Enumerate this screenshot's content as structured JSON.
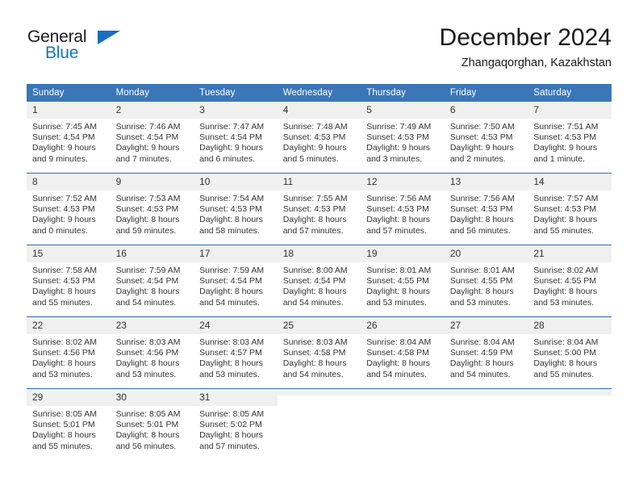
{
  "brand": {
    "name_part1": "General",
    "name_part2": "Blue",
    "flag_icon": "triangle-flag-icon"
  },
  "header": {
    "title": "December 2024",
    "location": "Zhangaqorghan, Kazakhstan"
  },
  "colors": {
    "header_blue": "#3b76b8",
    "row_divider_blue": "#2b6cb0",
    "daynum_band": "#f0f0f0",
    "brand_blue": "#1574c4"
  },
  "weekday_headers": [
    "Sunday",
    "Monday",
    "Tuesday",
    "Wednesday",
    "Thursday",
    "Friday",
    "Saturday"
  ],
  "weeks": [
    [
      {
        "day": "1",
        "sunrise": "Sunrise: 7:45 AM",
        "sunset": "Sunset: 4:54 PM",
        "daylight1": "Daylight: 9 hours",
        "daylight2": "and 9 minutes."
      },
      {
        "day": "2",
        "sunrise": "Sunrise: 7:46 AM",
        "sunset": "Sunset: 4:54 PM",
        "daylight1": "Daylight: 9 hours",
        "daylight2": "and 7 minutes."
      },
      {
        "day": "3",
        "sunrise": "Sunrise: 7:47 AM",
        "sunset": "Sunset: 4:54 PM",
        "daylight1": "Daylight: 9 hours",
        "daylight2": "and 6 minutes."
      },
      {
        "day": "4",
        "sunrise": "Sunrise: 7:48 AM",
        "sunset": "Sunset: 4:53 PM",
        "daylight1": "Daylight: 9 hours",
        "daylight2": "and 5 minutes."
      },
      {
        "day": "5",
        "sunrise": "Sunrise: 7:49 AM",
        "sunset": "Sunset: 4:53 PM",
        "daylight1": "Daylight: 9 hours",
        "daylight2": "and 3 minutes."
      },
      {
        "day": "6",
        "sunrise": "Sunrise: 7:50 AM",
        "sunset": "Sunset: 4:53 PM",
        "daylight1": "Daylight: 9 hours",
        "daylight2": "and 2 minutes."
      },
      {
        "day": "7",
        "sunrise": "Sunrise: 7:51 AM",
        "sunset": "Sunset: 4:53 PM",
        "daylight1": "Daylight: 9 hours",
        "daylight2": "and 1 minute."
      }
    ],
    [
      {
        "day": "8",
        "sunrise": "Sunrise: 7:52 AM",
        "sunset": "Sunset: 4:53 PM",
        "daylight1": "Daylight: 9 hours",
        "daylight2": "and 0 minutes."
      },
      {
        "day": "9",
        "sunrise": "Sunrise: 7:53 AM",
        "sunset": "Sunset: 4:53 PM",
        "daylight1": "Daylight: 8 hours",
        "daylight2": "and 59 minutes."
      },
      {
        "day": "10",
        "sunrise": "Sunrise: 7:54 AM",
        "sunset": "Sunset: 4:53 PM",
        "daylight1": "Daylight: 8 hours",
        "daylight2": "and 58 minutes."
      },
      {
        "day": "11",
        "sunrise": "Sunrise: 7:55 AM",
        "sunset": "Sunset: 4:53 PM",
        "daylight1": "Daylight: 8 hours",
        "daylight2": "and 57 minutes."
      },
      {
        "day": "12",
        "sunrise": "Sunrise: 7:56 AM",
        "sunset": "Sunset: 4:53 PM",
        "daylight1": "Daylight: 8 hours",
        "daylight2": "and 57 minutes."
      },
      {
        "day": "13",
        "sunrise": "Sunrise: 7:56 AM",
        "sunset": "Sunset: 4:53 PM",
        "daylight1": "Daylight: 8 hours",
        "daylight2": "and 56 minutes."
      },
      {
        "day": "14",
        "sunrise": "Sunrise: 7:57 AM",
        "sunset": "Sunset: 4:53 PM",
        "daylight1": "Daylight: 8 hours",
        "daylight2": "and 55 minutes."
      }
    ],
    [
      {
        "day": "15",
        "sunrise": "Sunrise: 7:58 AM",
        "sunset": "Sunset: 4:53 PM",
        "daylight1": "Daylight: 8 hours",
        "daylight2": "and 55 minutes."
      },
      {
        "day": "16",
        "sunrise": "Sunrise: 7:59 AM",
        "sunset": "Sunset: 4:54 PM",
        "daylight1": "Daylight: 8 hours",
        "daylight2": "and 54 minutes."
      },
      {
        "day": "17",
        "sunrise": "Sunrise: 7:59 AM",
        "sunset": "Sunset: 4:54 PM",
        "daylight1": "Daylight: 8 hours",
        "daylight2": "and 54 minutes."
      },
      {
        "day": "18",
        "sunrise": "Sunrise: 8:00 AM",
        "sunset": "Sunset: 4:54 PM",
        "daylight1": "Daylight: 8 hours",
        "daylight2": "and 54 minutes."
      },
      {
        "day": "19",
        "sunrise": "Sunrise: 8:01 AM",
        "sunset": "Sunset: 4:55 PM",
        "daylight1": "Daylight: 8 hours",
        "daylight2": "and 53 minutes."
      },
      {
        "day": "20",
        "sunrise": "Sunrise: 8:01 AM",
        "sunset": "Sunset: 4:55 PM",
        "daylight1": "Daylight: 8 hours",
        "daylight2": "and 53 minutes."
      },
      {
        "day": "21",
        "sunrise": "Sunrise: 8:02 AM",
        "sunset": "Sunset: 4:55 PM",
        "daylight1": "Daylight: 8 hours",
        "daylight2": "and 53 minutes."
      }
    ],
    [
      {
        "day": "22",
        "sunrise": "Sunrise: 8:02 AM",
        "sunset": "Sunset: 4:56 PM",
        "daylight1": "Daylight: 8 hours",
        "daylight2": "and 53 minutes."
      },
      {
        "day": "23",
        "sunrise": "Sunrise: 8:03 AM",
        "sunset": "Sunset: 4:56 PM",
        "daylight1": "Daylight: 8 hours",
        "daylight2": "and 53 minutes."
      },
      {
        "day": "24",
        "sunrise": "Sunrise: 8:03 AM",
        "sunset": "Sunset: 4:57 PM",
        "daylight1": "Daylight: 8 hours",
        "daylight2": "and 53 minutes."
      },
      {
        "day": "25",
        "sunrise": "Sunrise: 8:03 AM",
        "sunset": "Sunset: 4:58 PM",
        "daylight1": "Daylight: 8 hours",
        "daylight2": "and 54 minutes."
      },
      {
        "day": "26",
        "sunrise": "Sunrise: 8:04 AM",
        "sunset": "Sunset: 4:58 PM",
        "daylight1": "Daylight: 8 hours",
        "daylight2": "and 54 minutes."
      },
      {
        "day": "27",
        "sunrise": "Sunrise: 8:04 AM",
        "sunset": "Sunset: 4:59 PM",
        "daylight1": "Daylight: 8 hours",
        "daylight2": "and 54 minutes."
      },
      {
        "day": "28",
        "sunrise": "Sunrise: 8:04 AM",
        "sunset": "Sunset: 5:00 PM",
        "daylight1": "Daylight: 8 hours",
        "daylight2": "and 55 minutes."
      }
    ],
    [
      {
        "day": "29",
        "sunrise": "Sunrise: 8:05 AM",
        "sunset": "Sunset: 5:01 PM",
        "daylight1": "Daylight: 8 hours",
        "daylight2": "and 55 minutes."
      },
      {
        "day": "30",
        "sunrise": "Sunrise: 8:05 AM",
        "sunset": "Sunset: 5:01 PM",
        "daylight1": "Daylight: 8 hours",
        "daylight2": "and 56 minutes."
      },
      {
        "day": "31",
        "sunrise": "Sunrise: 8:05 AM",
        "sunset": "Sunset: 5:02 PM",
        "daylight1": "Daylight: 8 hours",
        "daylight2": "and 57 minutes."
      },
      {
        "day": "",
        "sunrise": "",
        "sunset": "",
        "daylight1": "",
        "daylight2": "",
        "empty": true
      },
      {
        "day": "",
        "sunrise": "",
        "sunset": "",
        "daylight1": "",
        "daylight2": "",
        "empty": true
      },
      {
        "day": "",
        "sunrise": "",
        "sunset": "",
        "daylight1": "",
        "daylight2": "",
        "empty": true
      },
      {
        "day": "",
        "sunrise": "",
        "sunset": "",
        "daylight1": "",
        "daylight2": "",
        "empty": true
      }
    ]
  ]
}
